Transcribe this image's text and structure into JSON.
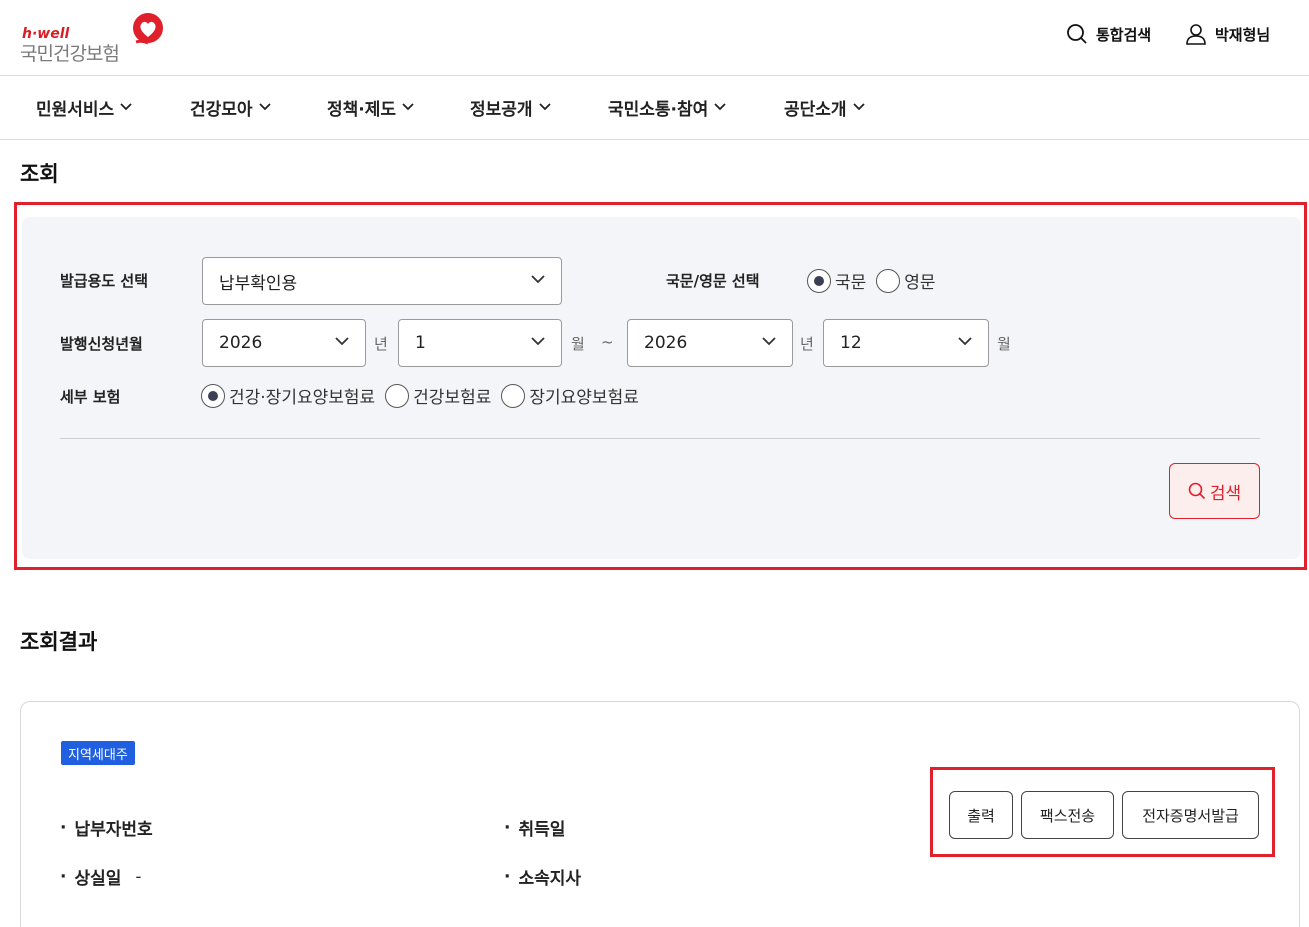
{
  "header": {
    "logo_tag": "h·well",
    "logo_name": "국민건강보험",
    "search_label": "통합검색",
    "user_label": "박재형님"
  },
  "nav": {
    "items": [
      {
        "label": "민원서비스"
      },
      {
        "label": "건강모아"
      },
      {
        "label": "정책·제도"
      },
      {
        "label": "정보공개"
      },
      {
        "label": "국민소통·참여"
      },
      {
        "label": "공단소개"
      }
    ]
  },
  "query": {
    "title": "조회",
    "purpose_label": "발급용도 선택",
    "purpose_value": "납부확인용",
    "language_label": "국문/영문 선택",
    "language_options": [
      {
        "label": "국문",
        "checked": true
      },
      {
        "label": "영문",
        "checked": false
      }
    ],
    "period_label": "발행신청년월",
    "start_year": "2026",
    "start_month": "1",
    "end_year": "2026",
    "end_month": "12",
    "year_unit": "년",
    "month_unit": "월",
    "range_sep": "~",
    "detail_label": "세부 보험",
    "detail_options": [
      {
        "label": "건강·장기요양보험료",
        "checked": true
      },
      {
        "label": "건강보험료",
        "checked": false
      },
      {
        "label": "장기요양보험료",
        "checked": false
      }
    ],
    "search_button": "검색"
  },
  "result": {
    "title": "조회결과",
    "badge": "지역세대주",
    "fields": {
      "payer_no_label": "납부자번호",
      "acquired_label": "취득일",
      "lost_label": "상실일",
      "lost_value": "-",
      "branch_label": "소속지사"
    },
    "buttons": {
      "print": "출력",
      "fax": "팩스전송",
      "e_cert": "전자증명서발급"
    }
  },
  "colors": {
    "brand_red": "#e0202a",
    "badge_blue": "#1f5fe0",
    "panel_bg": "#f4f5f9"
  }
}
